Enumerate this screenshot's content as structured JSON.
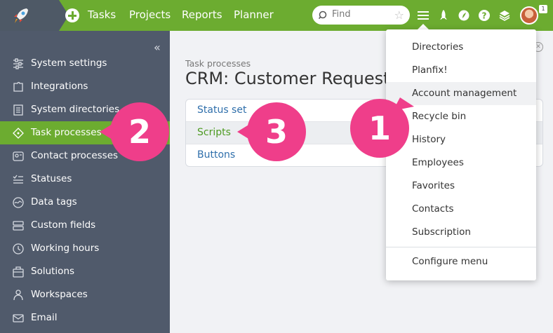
{
  "header": {
    "nav": [
      "Tasks",
      "Projects",
      "Reports",
      "Planner"
    ],
    "search_placeholder": "Find",
    "notification_count": "1"
  },
  "sidebar": {
    "collapse_label": "«",
    "items": [
      {
        "label": "System settings",
        "icon": "sliders-icon"
      },
      {
        "label": "Integrations",
        "icon": "puzzle-icon"
      },
      {
        "label": "System directories",
        "icon": "book-icon"
      },
      {
        "label": "Task processes",
        "icon": "diamond-icon",
        "active": true
      },
      {
        "label": "Contact processes",
        "icon": "contact-card-icon"
      },
      {
        "label": "Statuses",
        "icon": "status-list-icon"
      },
      {
        "label": "Data tags",
        "icon": "tag-wave-icon"
      },
      {
        "label": "Custom fields",
        "icon": "fields-icon"
      },
      {
        "label": "Working hours",
        "icon": "clock-icon"
      },
      {
        "label": "Solutions",
        "icon": "box-icon"
      },
      {
        "label": "Workspaces",
        "icon": "workspace-icon"
      },
      {
        "label": "Email",
        "icon": "envelope-icon"
      }
    ]
  },
  "main": {
    "breadcrumb": "Task processes",
    "title": "CRM: Customer Request",
    "tabs": [
      "Status set",
      "Scripts",
      "Buttons"
    ],
    "selected_tab": "Scripts"
  },
  "menu": {
    "items": [
      "Directories",
      "Planfix!",
      "Account management",
      "Recycle bin",
      "History",
      "Employees",
      "Favorites",
      "Contacts",
      "Subscription"
    ],
    "hovered": "Account management",
    "footer_item": "Configure menu"
  },
  "callouts": [
    "1",
    "2",
    "3"
  ],
  "colors": {
    "accent_green": "#6cac30",
    "sidebar_bg": "#505a6b",
    "callout_pink": "#ef3e8a",
    "link_blue": "#2f6fab"
  }
}
